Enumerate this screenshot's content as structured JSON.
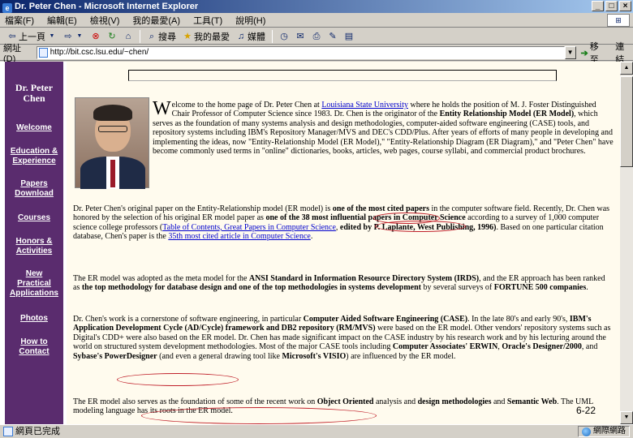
{
  "window": {
    "title": "Dr. Peter Chen - Microsoft Internet Explorer",
    "min": "_",
    "max": "□",
    "close": "×"
  },
  "menu": [
    "檔案(F)",
    "編輯(E)",
    "檢視(V)",
    "我的最愛(A)",
    "工具(T)",
    "說明(H)"
  ],
  "toolbar": {
    "back": "上一頁",
    "search": "搜尋",
    "favorites": "我的最愛",
    "media": "媒體"
  },
  "address": {
    "label": "網址(D)",
    "value": "http://bit.csc.lsu.edu/~chen/",
    "go": "移至",
    "links": "連結"
  },
  "sidebar": {
    "name": "Dr. Peter Chen",
    "links": [
      "Welcome",
      "Education & Experience",
      "Papers Download",
      "Courses",
      "Honors & Activities",
      "New Practical Applications",
      "Photos",
      "How to Contact"
    ]
  },
  "content": {
    "intro_w": "W",
    "intro_1": "elcome to the home page of Dr. Peter Chen at ",
    "intro_lsu": "Louisiana State University",
    "intro_2": " where he holds the position of M. J. Foster Distinguished Chair Professor of Computer Science since 1983. Dr. Chen is the originator of the ",
    "intro_er": "Entity Relationship Model (ER Model)",
    "intro_3": ", which serves as the foundation of many systems analysis and design methodologies, computer-aided software engineering (CASE) tools, and repository systems including IBM's Repository Manager/MVS and DEC's CDD/Plus. After years of efforts of many people in developing and implementing the ideas, now \"Entity-Relationship Model (ER Model),\" \"Entity-Relationship Diagram (ER Diagram),\" and \"Peter Chen\" have become commonly used terms in \"online\" dictionaries, books, articles, web pages, course syllabi, and commercial product brochures.",
    "p2_1": "Dr. Peter Chen's original paper on the Entity-Relationship model (ER model) is ",
    "p2_b1": "one of the most cited papers",
    "p2_2": " in the computer software field. Recently, Dr. Chen was honored by the selection of his original ER model paper as ",
    "p2_b2": "one of the 38 most influential papers in Computer Science",
    "p2_3": " according to a survey of 1,000 computer science college professors (",
    "p2_link1": "Table of Contents, Great Papers in Computer Science",
    "p2_4": ", ",
    "p2_b3": "edited by P. Laplante, West Publishing, 1996)",
    "p2_5": ". Based on one particular citation database, Chen's paper is the ",
    "p2_link2": "35th most cited article in Computer Science",
    "p2_6": ".",
    "p3_1": "The ER model was adopted as the meta model for the ",
    "p3_b1": "ANSI Standard in Information Resource Directory System (IRDS)",
    "p3_2": ", and the ER approach has been ranked as ",
    "p3_b2": "the top methodology for database design and one of the top methodologies in systems development",
    "p3_3": " by several surveys of ",
    "p3_b3": "FORTUNE 500 companies",
    "p3_4": ".",
    "p4_1": "Dr. Chen's work is a cornerstone of software engineering, in particular ",
    "p4_b1": "Computer Aided Software Engineering (CASE)",
    "p4_2": ". In the late 80's and early 90's, ",
    "p4_b2": "IBM's Application Development Cycle (AD/Cycle) framework and DB2 repository (RM/MVS)",
    "p4_3": " were based on the ER model. Other vendors' repository systems such as Digital's CDD+ were also based on the ER model. Dr. Chen has made significant impact on the CASE industry by his research work and by his lecturing around the world on structured system development methodologies. Most of the major CASE tools including ",
    "p4_b3": "Computer Associates' ERWIN",
    "p4_4": ", ",
    "p4_b4": "Oracle's Designer/2000",
    "p4_5": ", and ",
    "p4_b5": "Sybase's PowerDesigner",
    "p4_6": " (and even a general drawing tool like ",
    "p4_b6": "Microsoft's VISIO",
    "p4_7": ") are influenced by the ER model.",
    "p5_1": "The ER model also serves as the foundation of some of the recent work on ",
    "p5_b1": "Object Oriented",
    "p5_2": " analysis and ",
    "p5_b2": "design methodologies",
    "p5_3": " and ",
    "p5_b3": "Semantic Web",
    "p5_4": ". The UML modeling language has its roots in the ER model."
  },
  "slide_number": "6-22",
  "status": {
    "text": "網頁已完成",
    "zone": "網際網路"
  }
}
